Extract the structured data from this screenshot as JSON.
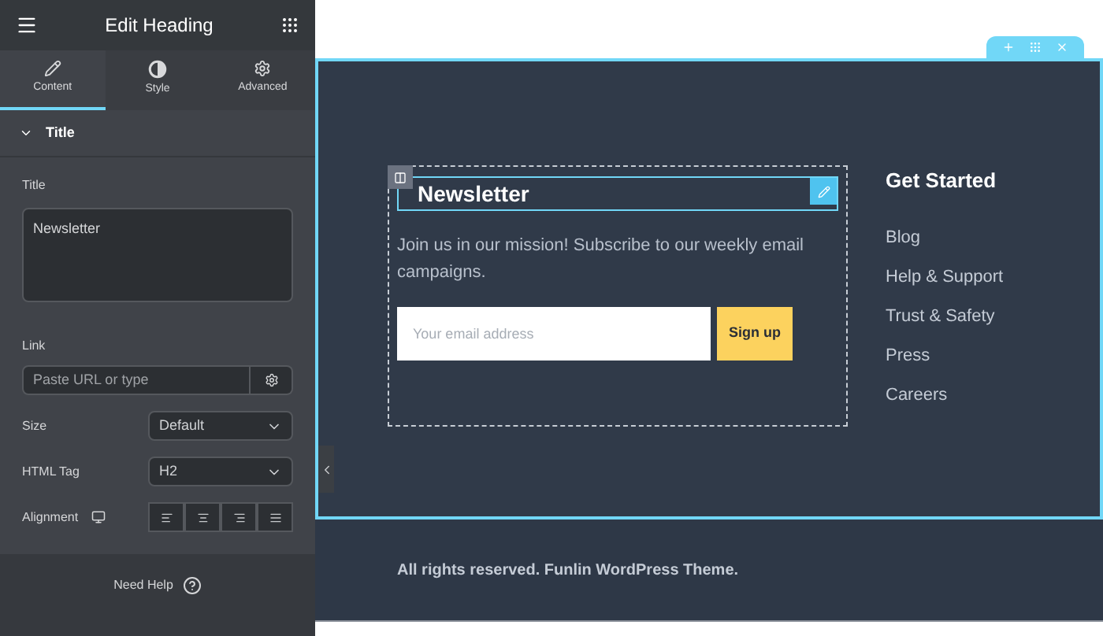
{
  "panel": {
    "title": "Edit Heading",
    "tabs": [
      {
        "label": "Content",
        "kind": "content",
        "selected": true
      },
      {
        "label": "Style",
        "kind": "style",
        "selected": false
      },
      {
        "label": "Advanced",
        "kind": "advanced",
        "selected": false
      }
    ],
    "section": {
      "title": "Title",
      "expanded": true
    },
    "title_field": {
      "label": "Title",
      "value": "Newsletter"
    },
    "link_field": {
      "label": "Link",
      "placeholder": "Paste URL or type"
    },
    "size": {
      "label": "Size",
      "value": "Default"
    },
    "html_tag": {
      "label": "HTML Tag",
      "value": "H2"
    },
    "alignment": {
      "label": "Alignment",
      "options": [
        {
          "kind": "left",
          "selected": false
        },
        {
          "kind": "center",
          "selected": false
        },
        {
          "kind": "right",
          "selected": false
        },
        {
          "kind": "justify",
          "selected": false
        }
      ]
    },
    "help": "Need Help"
  },
  "canvas": {
    "heading": "Newsletter",
    "text": "Join us in our mission! Subscribe to our weekly email campaigns.",
    "email_placeholder": "Your email address",
    "signup": "Sign up",
    "links_title": "Get Started",
    "links": [
      "Blog",
      "Help & Support",
      "Trust & Safety",
      "Press",
      "Careers"
    ],
    "footer": "All rights reserved. Funlin WordPress Theme."
  }
}
